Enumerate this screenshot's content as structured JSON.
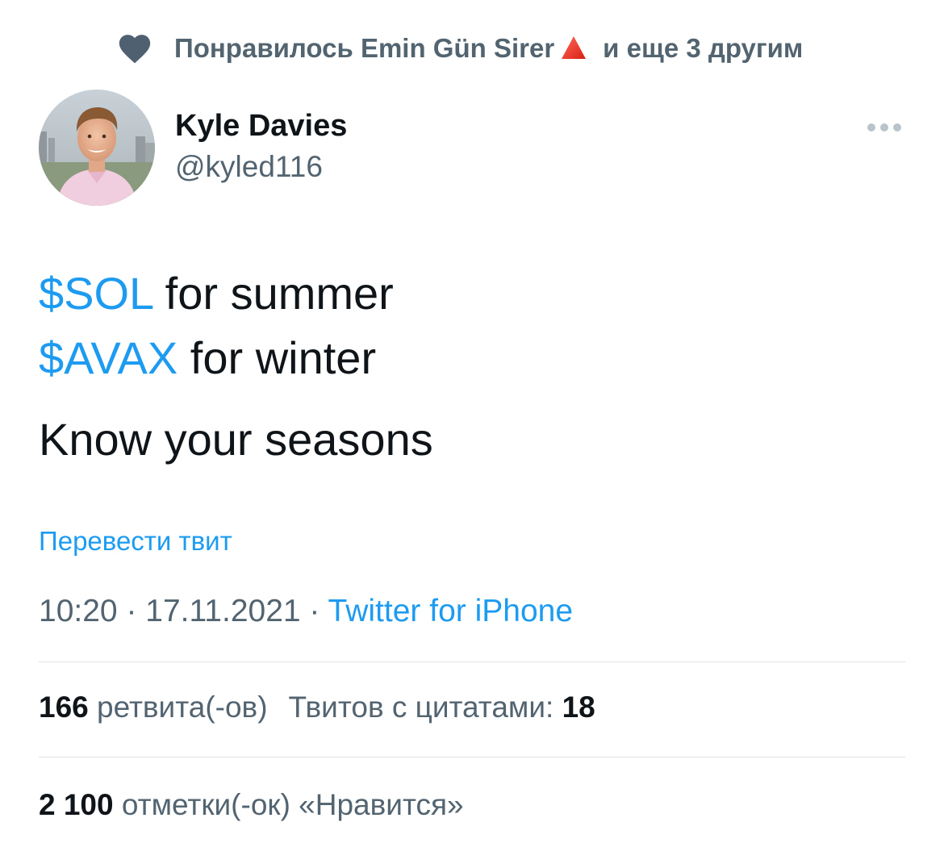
{
  "social_context": {
    "text_before": "Понравилось Emin Gün Sirer",
    "emoji": "red-triangle-icon",
    "text_after": "и еще 3 другим",
    "icon": "heart-icon"
  },
  "author": {
    "name": "Kyle Davies",
    "handle": "@kyled116",
    "avatar": "avatar-photo"
  },
  "tweet": {
    "line1_cashtag": "$SOL",
    "line1_rest": " for summer",
    "line2_cashtag": "$AVAX",
    "line2_rest": " for winter",
    "line3": "Know your seasons"
  },
  "translate_label": "Перевести твит",
  "meta": {
    "time": "10:20",
    "sep1": " · ",
    "date": "17.11.2021",
    "sep2": " · ",
    "source": "Twitter for iPhone"
  },
  "stats": {
    "retweets_count": "166",
    "retweets_label": " ретвита(-ов)",
    "quotes_label": "Твитов с цитатами: ",
    "quotes_count": "18",
    "likes_count": "2 100",
    "likes_label": " отметки(-ок) «Нравится»"
  },
  "colors": {
    "accent": "#1d9bf0",
    "text_primary": "#0f1419",
    "text_secondary": "#536471",
    "divider": "#dfe4e8"
  }
}
